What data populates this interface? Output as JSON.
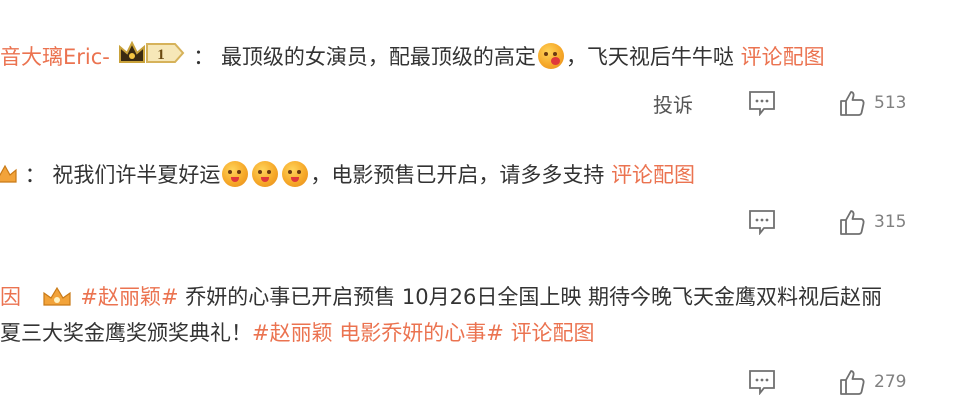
{
  "comments": [
    {
      "user": "音大璃Eric-",
      "badge_level": "1",
      "sep": "：",
      "text_parts": [
        {
          "type": "text",
          "value": "最顶级的女演员，配最顶级的高定"
        },
        {
          "type": "emoji",
          "value": "heart-eyes-emoji"
        },
        {
          "type": "text",
          "value": "，飞天视后牛牛哒 "
        },
        {
          "type": "link",
          "value": "评论配图"
        }
      ],
      "report_label": "投诉",
      "likes": "513"
    },
    {
      "sep": "：",
      "text_parts": [
        {
          "type": "text",
          "value": "祝我们许半夏好运"
        },
        {
          "type": "emoji",
          "value": "kiss-emoji"
        },
        {
          "type": "text",
          "value": "，电影预售已开启，请多多支持 "
        },
        {
          "type": "link",
          "value": "评论配图"
        }
      ],
      "likes": "315"
    },
    {
      "user_fragment": "因",
      "line1": {
        "tag": "#赵丽颖#",
        "text": " 乔妍的心事已开启预售 10月26日全国上映 期待今晚飞天金鹰双料视后赵丽"
      },
      "line2": {
        "text": "夏三大奖金鹰奖颁奖典礼！",
        "tag": "#赵丽颖 电影乔妍的心事#",
        "link": "评论配图"
      },
      "likes": "279"
    }
  ],
  "colors": {
    "link": "#eb7350",
    "text": "#333333",
    "muted": "#808080"
  }
}
